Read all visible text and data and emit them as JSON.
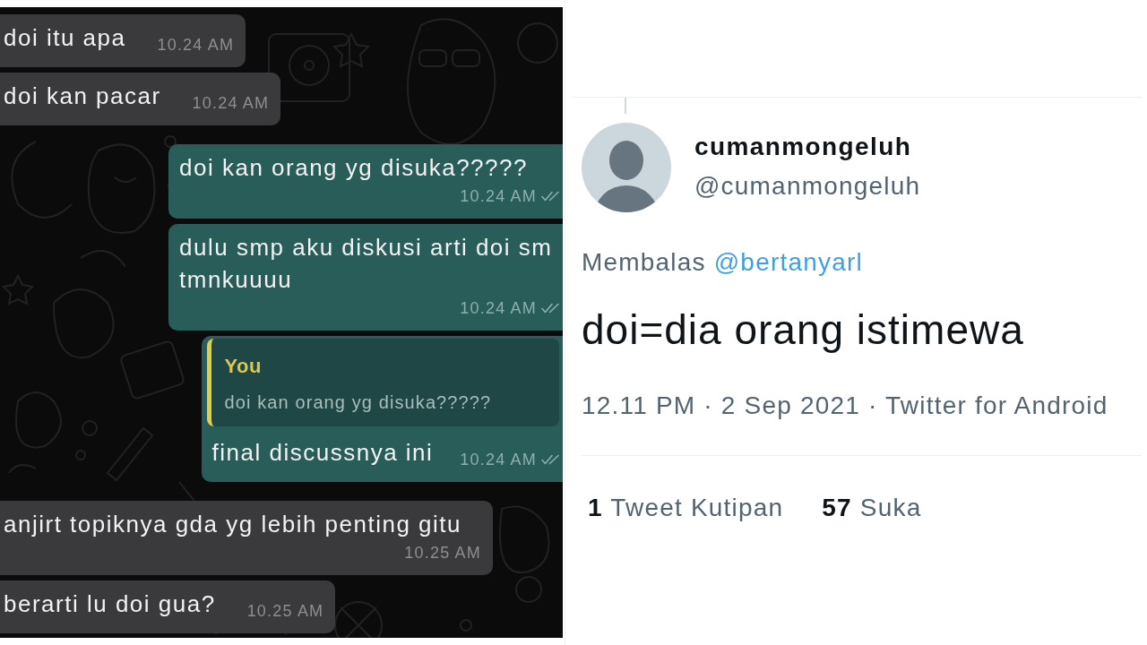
{
  "chat": {
    "messages": [
      {
        "kind": "incoming",
        "text": "doi itu apa",
        "time": "10.24 AM"
      },
      {
        "kind": "incoming",
        "text": "doi kan pacar",
        "time": "10.24 AM"
      },
      {
        "kind": "outgoing",
        "text": "doi kan orang yg disuka?????",
        "time": "10.24 AM",
        "read": false
      },
      {
        "kind": "outgoing",
        "text": "dulu smp aku diskusi arti doi sm tmnkuuuu",
        "time": "10.24 AM",
        "read": false
      },
      {
        "kind": "outgoing",
        "quote": {
          "author": "You",
          "text": "doi kan orang yg disuka?????"
        },
        "text": "final discussnya ini",
        "time": "10.24 AM",
        "read": false
      },
      {
        "kind": "incoming",
        "text": "anjirt topiknya gda yg lebih penting gitu",
        "time": "10.25 AM"
      },
      {
        "kind": "incoming",
        "text": "berarti lu doi gua?",
        "time": "10.25 AM"
      }
    ]
  },
  "tweet": {
    "display_name": "cumanmongeluh",
    "handle": "@cumanmongeluh",
    "reply": {
      "prefix": "Membalas",
      "mention": "@bertanyarl"
    },
    "text": "doi=dia orang istimewa",
    "meta": "12.11 PM · 2 Sep 2021 · Twitter for Android",
    "stats": [
      {
        "count": "1",
        "label": "Tweet Kutipan"
      },
      {
        "count": "57",
        "label": "Suka"
      }
    ]
  }
}
